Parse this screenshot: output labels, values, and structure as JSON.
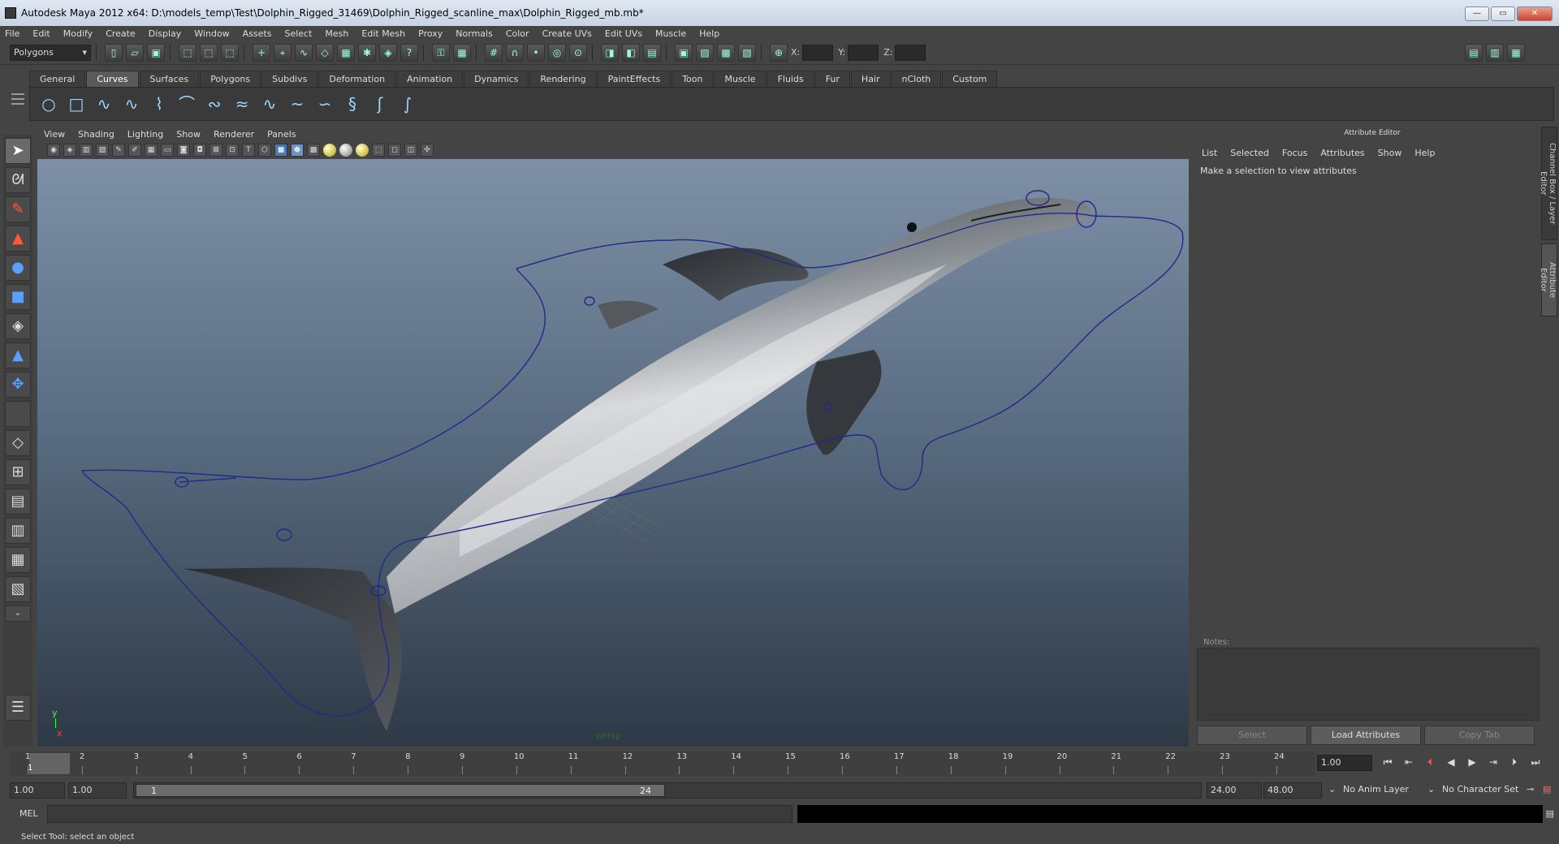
{
  "window": {
    "title": "Autodesk Maya 2012 x64: D:\\models_temp\\Test\\Dolphin_Rigged_31469\\Dolphin_Rigged_scanline_max\\Dolphin_Rigged_mb.mb*"
  },
  "menubar": [
    "File",
    "Edit",
    "Modify",
    "Create",
    "Display",
    "Window",
    "Assets",
    "Select",
    "Mesh",
    "Edit Mesh",
    "Proxy",
    "Normals",
    "Color",
    "Create UVs",
    "Edit UVs",
    "Muscle",
    "Help"
  ],
  "statusline": {
    "mode": "Polygons",
    "x_label": "X:",
    "y_label": "Y:",
    "z_label": "Z:"
  },
  "shelf_tabs": [
    "General",
    "Curves",
    "Surfaces",
    "Polygons",
    "Subdivs",
    "Deformation",
    "Animation",
    "Dynamics",
    "Rendering",
    "PaintEffects",
    "Toon",
    "Muscle",
    "Fluids",
    "Fur",
    "Hair",
    "nCloth",
    "Custom"
  ],
  "shelf_active": "Curves",
  "panel_menu": [
    "View",
    "Shading",
    "Lighting",
    "Show",
    "Renderer",
    "Panels"
  ],
  "viewport": {
    "camera": "persp",
    "axis_y": "y",
    "axis_x": "x"
  },
  "attribute_editor": {
    "title": "Attribute Editor",
    "menu": [
      "List",
      "Selected",
      "Focus",
      "Attributes",
      "Show",
      "Help"
    ],
    "hint": "Make a selection to view attributes",
    "notes_label": "Notes:",
    "buttons": {
      "select": "Select",
      "load": "Load Attributes",
      "copy": "Copy Tab"
    }
  },
  "side_tabs": [
    "Channel Box / Layer Editor",
    "Attribute Editor"
  ],
  "timeline": {
    "ticks": [
      "1",
      "2",
      "3",
      "4",
      "5",
      "6",
      "7",
      "8",
      "9",
      "10",
      "11",
      "12",
      "13",
      "14",
      "15",
      "16",
      "17",
      "18",
      "19",
      "20",
      "21",
      "22",
      "23",
      "24"
    ],
    "current_frame": "1",
    "current_time": "1.00"
  },
  "range": {
    "start": "1.00",
    "playback_start": "1.00",
    "slider_start": "1",
    "slider_end": "24",
    "playback_end": "24.00",
    "end": "48.00",
    "anim_layer": "No Anim Layer",
    "character_set": "No Character Set"
  },
  "command": {
    "label": "MEL"
  },
  "help_line": "Select Tool: select an object"
}
